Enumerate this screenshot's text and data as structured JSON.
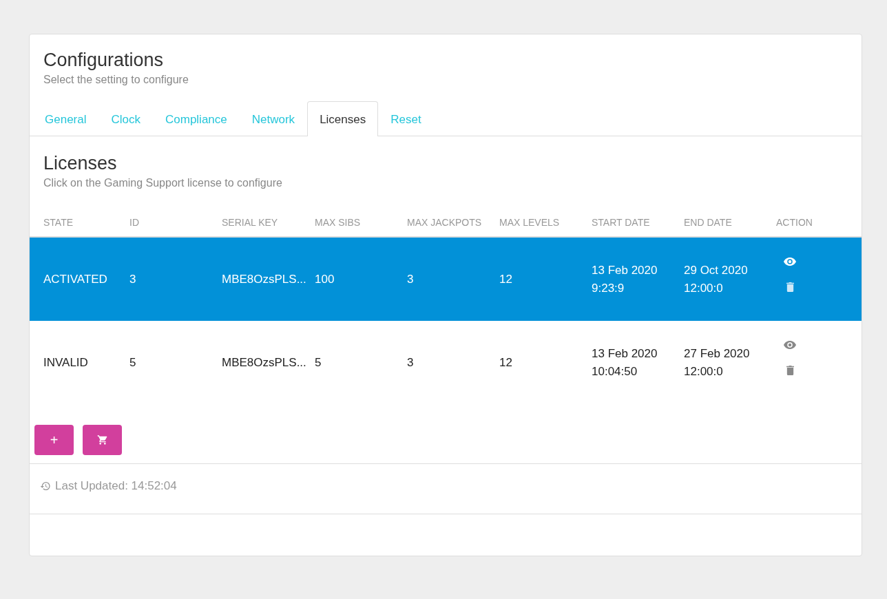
{
  "header": {
    "title": "Configurations",
    "subtitle": "Select the setting to configure"
  },
  "tabs": [
    {
      "label": "General",
      "selected": false
    },
    {
      "label": "Clock",
      "selected": false
    },
    {
      "label": "Compliance",
      "selected": false
    },
    {
      "label": "Network",
      "selected": false
    },
    {
      "label": "Licenses",
      "selected": true
    },
    {
      "label": "Reset",
      "selected": false
    }
  ],
  "section": {
    "title": "Licenses",
    "subtitle": "Click on the Gaming Support license to configure"
  },
  "table": {
    "columns": [
      "STATE",
      "ID",
      "SERIAL KEY",
      "MAX SIBS",
      "MAX JACKPOTS",
      "MAX LEVELS",
      "START DATE",
      "END DATE",
      "ACTION"
    ],
    "rows": [
      {
        "selected": true,
        "cells": [
          "ACTIVATED",
          "3",
          "MBE8OzsPLS...",
          "100",
          "3",
          "12"
        ],
        "start": [
          "13 Feb 2020",
          "9:23:9"
        ],
        "end": [
          "29 Oct 2020",
          "12:00:0"
        ]
      },
      {
        "selected": false,
        "cells": [
          "INVALID",
          "5",
          "MBE8OzsPLS...",
          "5",
          "3",
          "12"
        ],
        "start": [
          "13 Feb 2020",
          "10:04:50"
        ],
        "end": [
          "27 Feb 2020",
          "12:00:0"
        ]
      }
    ]
  },
  "add_button": "+",
  "footer": {
    "last_updated": "Last Updated: 14:52:04"
  }
}
